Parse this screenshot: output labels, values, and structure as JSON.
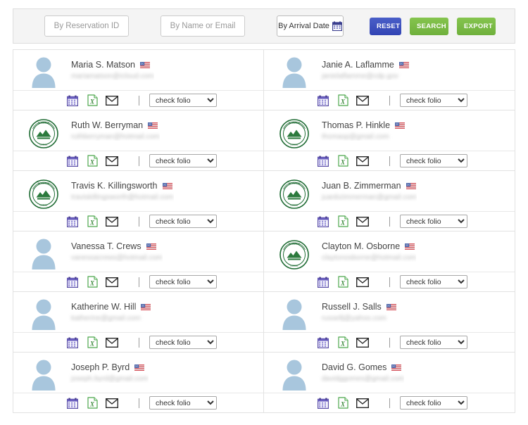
{
  "toolbar": {
    "reservation_placeholder": "By Reservation ID",
    "name_email_placeholder": "By Name or Email",
    "reservation_value": "",
    "name_email_value": "",
    "arrival_date_label": "By Arrival Date",
    "calendar_icon": "calendar-icon",
    "reset_label": "RESET",
    "search_label": "SEARCH",
    "export_label": "EXPORT",
    "colors": {
      "reset": "#3b4cbb",
      "search": "#7bbd45",
      "export": "#7bbd45",
      "toolbar_bg": "#f4f4f4",
      "border": "#dddddd"
    }
  },
  "actions": {
    "calendar_icon": "calendar-icon",
    "excel_icon": "excel-file-icon",
    "email_icon": "envelope-icon",
    "folio_selected": "check folio",
    "folio_options": [
      "check folio"
    ]
  },
  "guests": [
    {
      "name": "Maria S. Matson",
      "email": "mariamatson@icloud.com",
      "avatar": "person-placeholder",
      "flag": "us-flag-icon",
      "folio": "check folio"
    },
    {
      "name": "Janie A. Laflamme",
      "email": "janielaflamme@cdp.gov",
      "avatar": "person-placeholder",
      "flag": "us-flag-icon",
      "folio": "check folio"
    },
    {
      "name": "Ruth W. Berryman",
      "email": "ruthberryman@hotmail.com",
      "avatar": "lodge-logo",
      "flag": "us-flag-icon",
      "folio": "check folio"
    },
    {
      "name": "Thomas P. Hinkle",
      "email": "thomasp@gmail.com",
      "avatar": "lodge-logo",
      "flag": "us-flag-icon",
      "folio": "check folio"
    },
    {
      "name": "Travis K. Killingsworth",
      "email": "traviskillingsworth@hotmail.com",
      "avatar": "lodge-logo",
      "flag": "us-flag-icon",
      "folio": "check folio"
    },
    {
      "name": "Juan B. Zimmerman",
      "email": "juanbzimmerman@gmail.com",
      "avatar": "lodge-logo",
      "flag": "us-flag-icon",
      "folio": "check folio"
    },
    {
      "name": "Vanessa T. Crews",
      "email": "vanessacrews@hotmail.com",
      "avatar": "person-placeholder",
      "flag": "us-flag-icon",
      "folio": "check folio"
    },
    {
      "name": "Clayton M. Osborne",
      "email": "claytonosborne@hotmail.com",
      "avatar": "lodge-logo",
      "flag": "us-flag-icon",
      "folio": "check folio"
    },
    {
      "name": "Katherine W. Hill",
      "email": "katherine@gmail.com",
      "avatar": "person-placeholder",
      "flag": "us-flag-icon",
      "folio": "check folio"
    },
    {
      "name": "Russell J. Salls",
      "email": "russellj@yahoo.com",
      "avatar": "person-placeholder",
      "flag": "us-flag-icon",
      "folio": "check folio"
    },
    {
      "name": "Joseph P. Byrd",
      "email": "joseph.byrd@gmail.com",
      "avatar": "person-placeholder",
      "flag": "us-flag-icon",
      "folio": "check folio"
    },
    {
      "name": "David G. Gomes",
      "email": "davidggomes@gmail.com",
      "avatar": "person-placeholder",
      "flag": "us-flag-icon",
      "folio": "check folio"
    }
  ]
}
